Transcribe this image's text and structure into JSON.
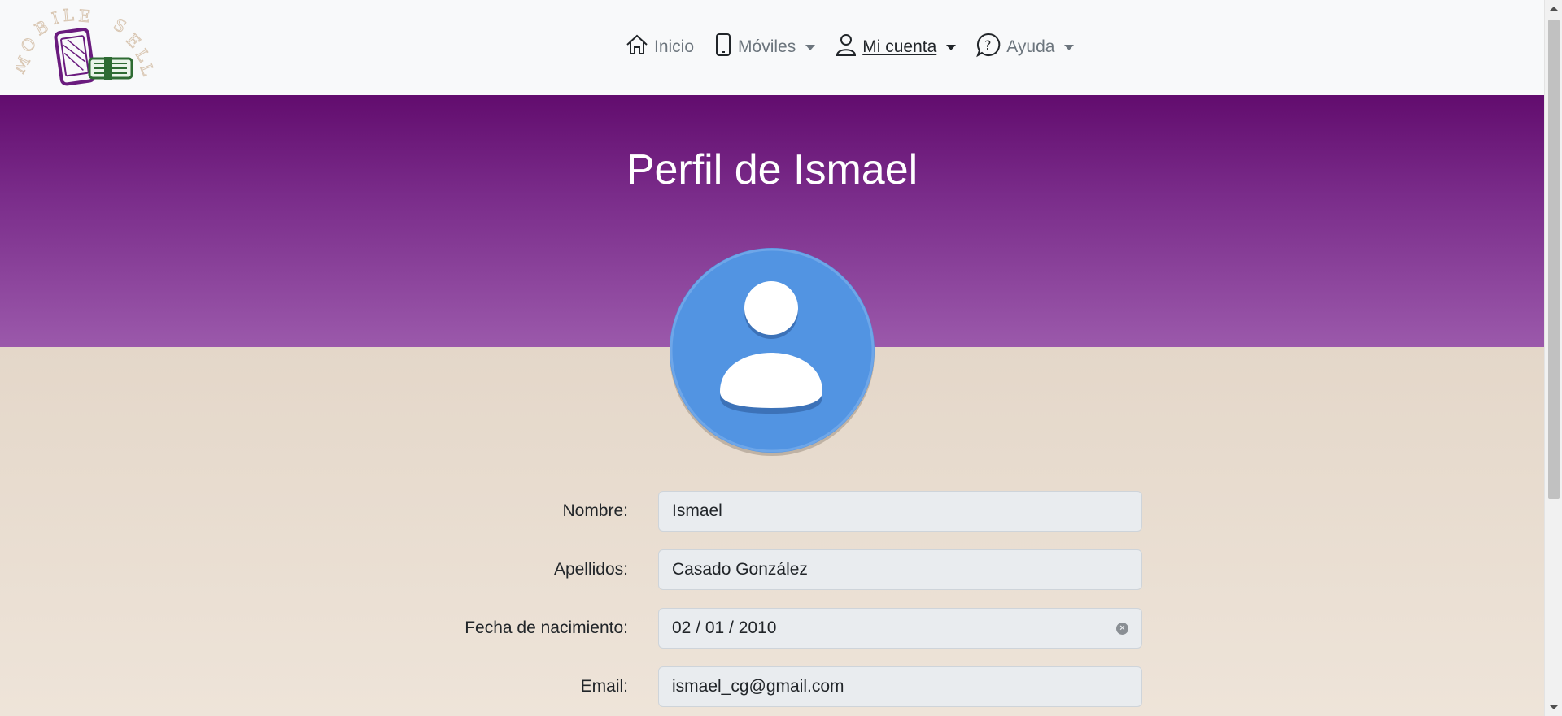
{
  "brand": {
    "logo_text": "MOBILE SELL"
  },
  "nav": {
    "items": [
      {
        "label": "Inicio",
        "icon": "home-icon"
      },
      {
        "label": "Móviles",
        "icon": "phone-icon"
      },
      {
        "label": "Mi cuenta",
        "icon": "user-icon"
      },
      {
        "label": "Ayuda",
        "icon": "help-icon"
      }
    ]
  },
  "page": {
    "title": "Perfil de Ismael"
  },
  "form": {
    "nombre": {
      "label": "Nombre:",
      "value": "Ismael"
    },
    "apellidos": {
      "label": "Apellidos:",
      "value": "Casado González"
    },
    "fecha": {
      "label": "Fecha de nacimiento:",
      "value": "02 / 01 / 2010"
    },
    "email": {
      "label": "Email:",
      "value": "ismael_cg@gmail.com"
    }
  },
  "colors": {
    "header_top": "#620c6e",
    "header_bottom": "#9b59ab",
    "avatar": "#5294e2",
    "background": "#efe6dc"
  }
}
